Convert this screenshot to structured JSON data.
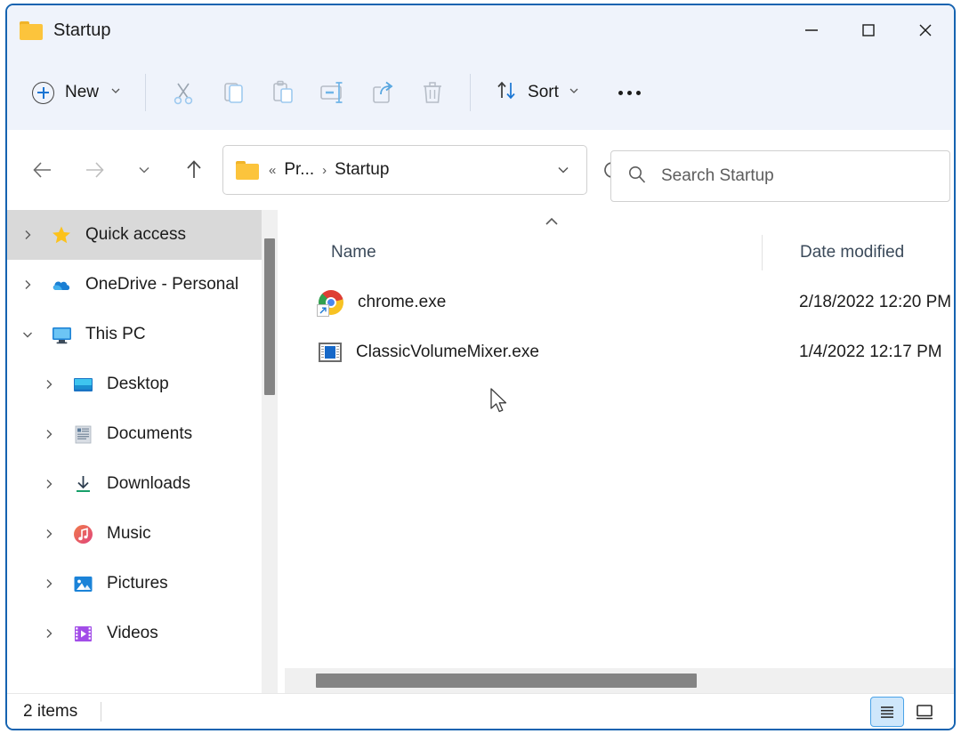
{
  "window": {
    "title": "Startup",
    "folder_icon": "folder-icon",
    "controls": {
      "minimize": "–",
      "maximize": "□",
      "close": "✕"
    }
  },
  "toolbar": {
    "new_label": "New",
    "new_icon": "plus-circle-icon",
    "new_chevron": "chevron-down-icon",
    "actions": [
      {
        "name": "cut-button",
        "icon": "scissors-icon"
      },
      {
        "name": "copy-button",
        "icon": "copy-icon"
      },
      {
        "name": "paste-button",
        "icon": "clipboard-icon"
      },
      {
        "name": "rename-button",
        "icon": "rename-icon"
      },
      {
        "name": "share-button",
        "icon": "share-icon"
      },
      {
        "name": "delete-button",
        "icon": "trash-icon"
      }
    ],
    "sort_label": "Sort",
    "sort_icon": "sort-arrows-icon",
    "more_label": "See more",
    "more_icon": "ellipsis-icon"
  },
  "address": {
    "back_icon": "arrow-left-icon",
    "forward_icon": "arrow-right-icon",
    "history_icon": "chevron-down-icon",
    "up_icon": "arrow-up-icon",
    "folder_icon": "folder-icon",
    "crumb_overflow": "«",
    "crumbs": [
      "Pr...",
      "Startup"
    ],
    "separator": "›",
    "dropdown_icon": "chevron-down-icon",
    "refresh_icon": "refresh-icon"
  },
  "search": {
    "placeholder": "Search Startup",
    "icon": "search-icon"
  },
  "sidebar": {
    "items": [
      {
        "label": "Quick access",
        "icon": "star-icon",
        "expanded": false,
        "selected": true,
        "child": false
      },
      {
        "label": "OneDrive - Personal",
        "icon": "cloud-icon",
        "expanded": false,
        "selected": false,
        "child": false
      },
      {
        "label": "This PC",
        "icon": "monitor-icon",
        "expanded": true,
        "selected": false,
        "child": false
      },
      {
        "label": "Desktop",
        "icon": "desktop-icon",
        "expanded": false,
        "selected": false,
        "child": true
      },
      {
        "label": "Documents",
        "icon": "documents-icon",
        "expanded": false,
        "selected": false,
        "child": true
      },
      {
        "label": "Downloads",
        "icon": "downloads-icon",
        "expanded": false,
        "selected": false,
        "child": true
      },
      {
        "label": "Music",
        "icon": "music-icon",
        "expanded": false,
        "selected": false,
        "child": true
      },
      {
        "label": "Pictures",
        "icon": "pictures-icon",
        "expanded": false,
        "selected": false,
        "child": true
      },
      {
        "label": "Videos",
        "icon": "videos-icon",
        "expanded": false,
        "selected": false,
        "child": true
      }
    ]
  },
  "file_list": {
    "sort_indicator": "chevron-up-icon",
    "columns": [
      "Name",
      "Date modified"
    ],
    "rows": [
      {
        "name": "chrome.exe",
        "date_modified": "2/18/2022 12:20 PM",
        "icon": "chrome-shortcut-icon"
      },
      {
        "name": "ClassicVolumeMixer.exe",
        "date_modified": "1/4/2022 12:17 PM",
        "icon": "volume-mixer-icon"
      }
    ]
  },
  "status": {
    "item_count": "2 items",
    "views": [
      {
        "name": "details-view-button",
        "icon": "list-lines-icon",
        "active": true
      },
      {
        "name": "large-icons-view-button",
        "icon": "thumbnail-icon",
        "active": false
      }
    ]
  },
  "colors": {
    "window_border": "#1563b0",
    "toolbar_bg": "#eff3fb",
    "accent": "#1774d3",
    "selection": "#d9d9d9",
    "scrollbar_thumb": "#848484"
  }
}
